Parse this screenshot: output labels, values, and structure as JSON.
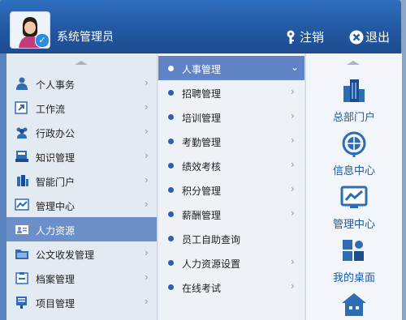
{
  "header": {
    "username": "系统管理员",
    "logout_label": "注销",
    "exit_label": "退出"
  },
  "menu_level1": [
    {
      "label": "个人事务",
      "icon": "person-icon"
    },
    {
      "label": "工作流",
      "icon": "workflow-icon"
    },
    {
      "label": "行政办公",
      "icon": "group-icon"
    },
    {
      "label": "知识管理",
      "icon": "knowledge-icon"
    },
    {
      "label": "智能门户",
      "icon": "portal-icon"
    },
    {
      "label": "管理中心",
      "icon": "chart-icon"
    },
    {
      "label": "人力资源",
      "icon": "hr-icon",
      "active": true
    },
    {
      "label": "公文收发管理",
      "icon": "folder-icon"
    },
    {
      "label": "档案管理",
      "icon": "archive-icon"
    },
    {
      "label": "项目管理",
      "icon": "project-icon"
    }
  ],
  "menu_level2": [
    {
      "label": "人事管理",
      "active": true,
      "has_sub": true
    },
    {
      "label": "招聘管理",
      "has_sub": true
    },
    {
      "label": "培训管理",
      "has_sub": true
    },
    {
      "label": "考勤管理",
      "has_sub": true
    },
    {
      "label": "绩效考核",
      "has_sub": true
    },
    {
      "label": "积分管理",
      "has_sub": true
    },
    {
      "label": "薪酬管理",
      "has_sub": true
    },
    {
      "label": "员工自助查询",
      "has_sub": false
    },
    {
      "label": "人力资源设置",
      "has_sub": true
    },
    {
      "label": "在线考试",
      "has_sub": true
    }
  ],
  "shortcuts": [
    {
      "label": "总部门户",
      "icon": "building-icon"
    },
    {
      "label": "信息中心",
      "icon": "info-globe-icon"
    },
    {
      "label": "管理中心",
      "icon": "monitor-chart-icon"
    },
    {
      "label": "我的桌面",
      "icon": "desktop-grid-icon"
    },
    {
      "label": "",
      "icon": "home-icon"
    }
  ],
  "colors": {
    "header": "#235aa3",
    "active_item": "#6d8fc9",
    "shortcut_text": "#1c5aa6"
  }
}
